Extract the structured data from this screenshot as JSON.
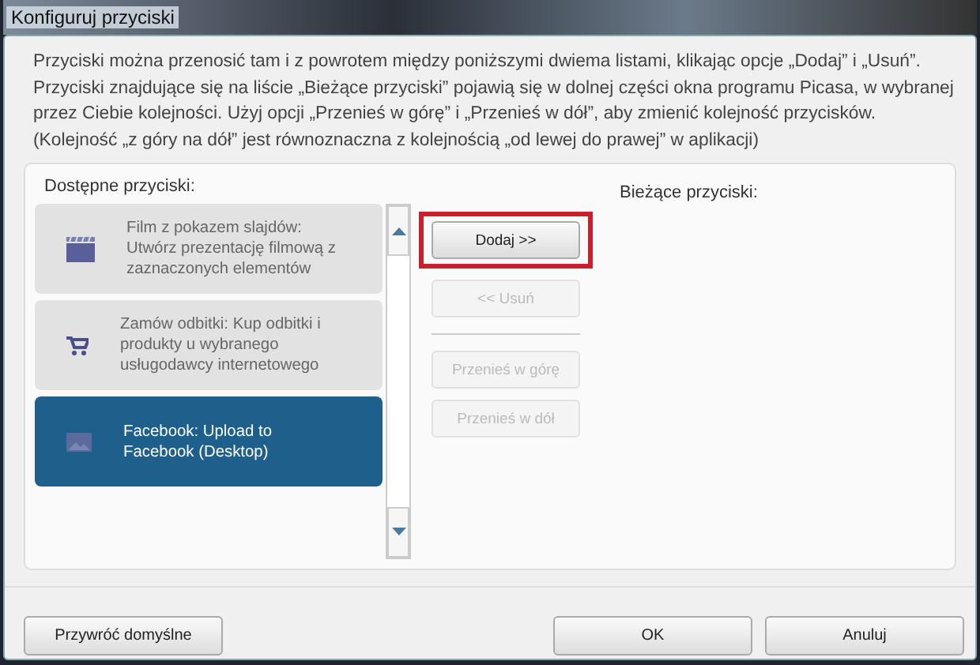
{
  "window": {
    "title": "Konfiguruj przyciski"
  },
  "description": "Przyciski można przenosić tam i z powrotem między poniższymi dwiema listami, klikając opcje „Dodaj” i „Usuń”. Przyciski znajdujące się na liście „Bieżące przyciski” pojawią się w dolnej części okna programu Picasa, w wybranej przez Ciebie kolejności. Użyj opcji „Przenieś w górę” i „Przenieś w dół”, aby zmienić kolejność przycisków. (Kolejność „z góry na dół” jest równoznaczna z kolejnością „od lewej do prawej” w aplikacji)",
  "available": {
    "label": "Dostępne przyciski:",
    "items": [
      {
        "kind": "film",
        "text": "Film z pokazem slajdów: Utwórz prezentację filmową z zaznaczonych elementów",
        "selected": false
      },
      {
        "kind": "cart",
        "text": "Zamów odbitki:  Kup odbitki i produkty u wybranego usługodawcy internetowego",
        "selected": false
      },
      {
        "kind": "image",
        "text": "Facebook:  Upload to Facebook (Desktop)",
        "selected": true
      }
    ]
  },
  "actions": [
    {
      "label": "Dodaj >>",
      "disabled": false,
      "highlighted": true
    },
    {
      "label": "<< Usuń",
      "disabled": true,
      "highlighted": false
    },
    {
      "label": "Przenieś w górę",
      "disabled": true,
      "highlighted": false
    },
    {
      "label": "Przenieś w dół",
      "disabled": true,
      "highlighted": false
    }
  ],
  "current": {
    "label": "Bieżące przyciski:"
  },
  "footer": {
    "restore": "Przywróć domyślne",
    "ok": "OK",
    "cancel": "Anuluj"
  }
}
